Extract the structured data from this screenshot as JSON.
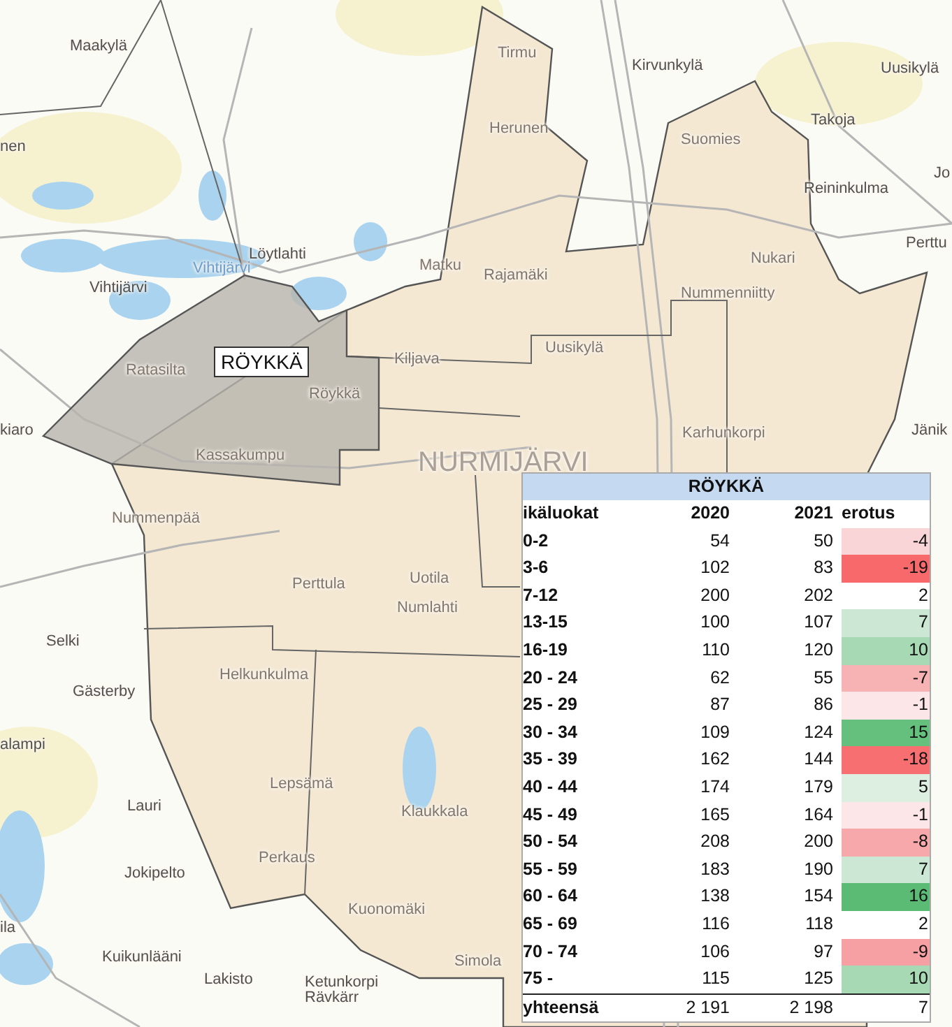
{
  "map": {
    "places": [
      {
        "name": "Maakylä",
        "kind": "village"
      },
      {
        "name": "Tirmu",
        "kind": "district"
      },
      {
        "name": "Kirvunkylä",
        "kind": "village"
      },
      {
        "name": "Uusikylä",
        "kind": "village"
      },
      {
        "name": "Takoja",
        "kind": "village"
      },
      {
        "name": "Herunen",
        "kind": "district"
      },
      {
        "name": "Suomies",
        "kind": "district"
      },
      {
        "name": "nen",
        "kind": "village"
      },
      {
        "name": "Reininkulma",
        "kind": "village"
      },
      {
        "name": "Jo",
        "kind": "village"
      },
      {
        "name": "Perttu",
        "kind": "village"
      },
      {
        "name": "Löytlahti",
        "kind": "village"
      },
      {
        "name": "Vihtijärvi",
        "kind": "lake"
      },
      {
        "name": "Vihtijärvi",
        "kind": "village"
      },
      {
        "name": "Matku",
        "kind": "district"
      },
      {
        "name": "Rajamäki",
        "kind": "district"
      },
      {
        "name": "Nukari",
        "kind": "district"
      },
      {
        "name": "Nummenniitty",
        "kind": "district"
      },
      {
        "name": "Kiljava",
        "kind": "district"
      },
      {
        "name": "Uusikylä",
        "kind": "district"
      },
      {
        "name": "Ratasilta",
        "kind": "district"
      },
      {
        "name": "Röykkä",
        "kind": "district"
      },
      {
        "name": "kiaro",
        "kind": "village"
      },
      {
        "name": "Kassakumpu",
        "kind": "district"
      },
      {
        "name": "NURMIJÄRVI",
        "kind": "municipality"
      },
      {
        "name": "Karhunkorpi",
        "kind": "district"
      },
      {
        "name": "Jänik",
        "kind": "village"
      },
      {
        "name": "Nummenpää",
        "kind": "district"
      },
      {
        "name": "Perttula",
        "kind": "district"
      },
      {
        "name": "Uotila",
        "kind": "district"
      },
      {
        "name": "Numlahti",
        "kind": "district"
      },
      {
        "name": "Selki",
        "kind": "village"
      },
      {
        "name": "Gästerby",
        "kind": "village"
      },
      {
        "name": "Helkunkulma",
        "kind": "district"
      },
      {
        "name": "alampi",
        "kind": "village"
      },
      {
        "name": "Lepsämä",
        "kind": "district"
      },
      {
        "name": "Lauri",
        "kind": "village"
      },
      {
        "name": "Klaukkala",
        "kind": "district"
      },
      {
        "name": "Perkaus",
        "kind": "district"
      },
      {
        "name": "Jokipelto",
        "kind": "village"
      },
      {
        "name": "Kuonomäki",
        "kind": "district"
      },
      {
        "name": "ila",
        "kind": "village"
      },
      {
        "name": "Simola",
        "kind": "district"
      },
      {
        "name": "Kuikunlääni",
        "kind": "village"
      },
      {
        "name": "Lakisto",
        "kind": "village"
      },
      {
        "name": "Ketunkorpi",
        "kind": "village"
      },
      {
        "name": "Rävkärr",
        "kind": "village"
      }
    ],
    "area_label": "RÖYKKÄ"
  },
  "table": {
    "title": "RÖYKKÄ",
    "columns": [
      "ikäluokat",
      "2020",
      "2021",
      "erotus"
    ],
    "rows": [
      {
        "age": "0-2",
        "y2020": "54",
        "y2021": "50",
        "diff": "-4",
        "color": "#f9d5d7"
      },
      {
        "age": "3-6",
        "y2020": "102",
        "y2021": "83",
        "diff": "-19",
        "color": "#f8696b"
      },
      {
        "age": "7-12",
        "y2020": "200",
        "y2021": "202",
        "diff": "2",
        "color": "#ffffff"
      },
      {
        "age": "13-15",
        "y2020": "100",
        "y2021": "107",
        "diff": "7",
        "color": "#cce8d4"
      },
      {
        "age": "16-19",
        "y2020": "110",
        "y2021": "120",
        "diff": "10",
        "color": "#a8d9b5"
      },
      {
        "age": "20 - 24",
        "y2020": "62",
        "y2021": "55",
        "diff": "-7",
        "color": "#f7b2b4"
      },
      {
        "age": "25 - 29",
        "y2020": "87",
        "y2021": "86",
        "diff": "-1",
        "color": "#fce6e7"
      },
      {
        "age": "30 - 34",
        "y2020": "109",
        "y2021": "124",
        "diff": "15",
        "color": "#65bf7d"
      },
      {
        "age": "35 - 39",
        "y2020": "162",
        "y2021": "144",
        "diff": "-18",
        "color": "#f86f72"
      },
      {
        "age": "40 - 44",
        "y2020": "174",
        "y2021": "179",
        "diff": "5",
        "color": "#dcefe1"
      },
      {
        "age": "45 - 49",
        "y2020": "165",
        "y2021": "164",
        "diff": "-1",
        "color": "#fce6e7"
      },
      {
        "age": "50 - 54",
        "y2020": "208",
        "y2021": "200",
        "diff": "-8",
        "color": "#f6a8aa"
      },
      {
        "age": "55 - 59",
        "y2020": "183",
        "y2021": "190",
        "diff": "7",
        "color": "#cce8d4"
      },
      {
        "age": "60 - 64",
        "y2020": "138",
        "y2021": "154",
        "diff": "16",
        "color": "#5bbb75"
      },
      {
        "age": "65 - 69",
        "y2020": "116",
        "y2021": "118",
        "diff": "2",
        "color": "#ffffff"
      },
      {
        "age": "70 - 74",
        "y2020": "106",
        "y2021": "97",
        "diff": "-9",
        "color": "#f6a0a3"
      },
      {
        "age": "75 -",
        "y2020": "115",
        "y2021": "125",
        "diff": "10",
        "color": "#a8d9b5"
      }
    ],
    "total": {
      "label": "yhteensä",
      "y2020": "2 191",
      "y2021": "2 198",
      "diff": "7"
    }
  }
}
